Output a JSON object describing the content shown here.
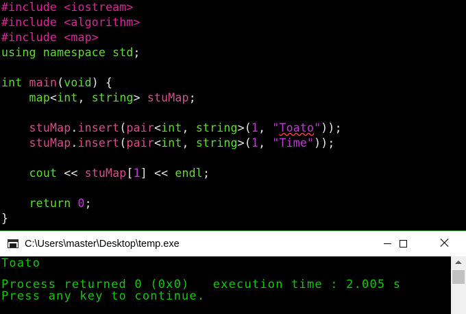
{
  "editor": {
    "lines": [
      [
        [
          "pp",
          "#include <iostream>"
        ]
      ],
      [
        [
          "pp",
          "#include <algorithm>"
        ]
      ],
      [
        [
          "pp",
          "#include <map>"
        ]
      ],
      [
        [
          "kw",
          "using namespace std"
        ],
        [
          "op",
          ";"
        ]
      ],
      [],
      [
        [
          "kw",
          "int "
        ],
        [
          "fn",
          "main"
        ],
        [
          "op",
          "("
        ],
        [
          "kw",
          "void"
        ],
        [
          "op",
          ") {"
        ]
      ],
      [
        [
          "op",
          "    "
        ],
        [
          "kw",
          "map"
        ],
        [
          "op",
          "<"
        ],
        [
          "kw",
          "int"
        ],
        [
          "op",
          ", "
        ],
        [
          "kw",
          "string"
        ],
        [
          "op",
          "> "
        ],
        [
          "id",
          "stuMap"
        ],
        [
          "op",
          ";"
        ]
      ],
      [],
      [
        [
          "op",
          "    "
        ],
        [
          "id",
          "stuMap"
        ],
        [
          "op",
          "."
        ],
        [
          "fn",
          "insert"
        ],
        [
          "op",
          "("
        ],
        [
          "fn",
          "pair"
        ],
        [
          "op",
          "<"
        ],
        [
          "kw",
          "int"
        ],
        [
          "op",
          ", "
        ],
        [
          "kw",
          "string"
        ],
        [
          "op",
          ">("
        ],
        [
          "num",
          "1"
        ],
        [
          "op",
          ", "
        ],
        [
          "str",
          "\""
        ],
        [
          "strtxt",
          "Toato"
        ],
        [
          "str",
          "\""
        ],
        [
          "op",
          "));"
        ]
      ],
      [
        [
          "op",
          "    "
        ],
        [
          "id",
          "stuMap"
        ],
        [
          "op",
          "."
        ],
        [
          "fn",
          "insert"
        ],
        [
          "op",
          "("
        ],
        [
          "fn",
          "pair"
        ],
        [
          "op",
          "<"
        ],
        [
          "kw",
          "int"
        ],
        [
          "op",
          ", "
        ],
        [
          "kw",
          "string"
        ],
        [
          "op",
          ">("
        ],
        [
          "num",
          "1"
        ],
        [
          "op",
          ", "
        ],
        [
          "str",
          "\"Time\""
        ],
        [
          "op",
          "));"
        ]
      ],
      [],
      [
        [
          "op",
          "    "
        ],
        [
          "kw",
          "cout"
        ],
        [
          "op",
          " << "
        ],
        [
          "id",
          "stuMap"
        ],
        [
          "op",
          "["
        ],
        [
          "num",
          "1"
        ],
        [
          "op",
          "] << "
        ],
        [
          "kw",
          "endl"
        ],
        [
          "op",
          ";"
        ]
      ],
      [],
      [
        [
          "op",
          "    "
        ],
        [
          "kw",
          "return "
        ],
        [
          "num",
          "0"
        ],
        [
          "op",
          ";"
        ]
      ],
      [
        [
          "op",
          "}"
        ]
      ]
    ]
  },
  "console": {
    "title": "C:\\Users\\master\\Desktop\\temp.exe",
    "output_line1": "Toato",
    "output_line2": "Process returned 0 (0x0)   execution time : 2.005 s",
    "output_line3": "Press any key to continue."
  },
  "colors": {
    "preprocessor": "#e0249b",
    "keyword": "#5dde2f",
    "identifier": "#d84d8c",
    "literal": "#c23bd6",
    "console_text": "#16c60c"
  }
}
